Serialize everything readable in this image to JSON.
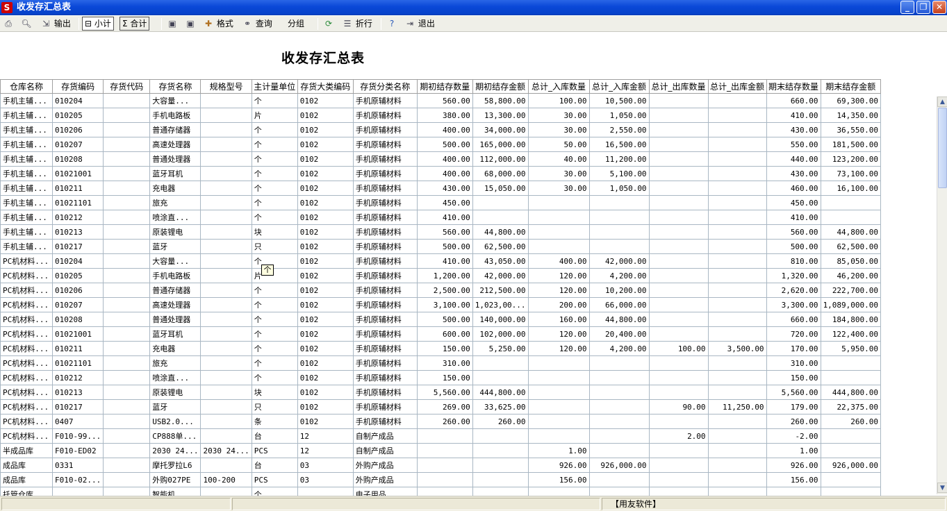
{
  "window": {
    "title": "收发存汇总表",
    "logo": "S",
    "min": "_",
    "restore": "❐",
    "close": "✕"
  },
  "toolbar": {
    "print_icon": "printer-icon",
    "preview_icon": "preview-icon",
    "output_icon": "export-icon",
    "output": "输出",
    "subtotal": "小计",
    "subtotal_glyph": "⊟",
    "total": "合计",
    "total_glyph": "Σ",
    "save_icon": "save-icon",
    "saveas_icon": "save-as-icon",
    "format": "格式",
    "query": "查询",
    "group": "分组",
    "refresh_icon": "refresh-icon",
    "wrap": "折行",
    "help_icon": "help-icon",
    "exit": "退出"
  },
  "report": {
    "title": "收发存汇总表",
    "columns": [
      "仓库名称",
      "存货编码",
      "存货代码",
      "存货名称",
      "规格型号",
      "主计量单位",
      "存货大类编码",
      "存货分类名称",
      "期初结存数量",
      "期初结存金额",
      "总计_入库数量",
      "总计_入库金额",
      "总计_出库数量",
      "总计_出库金额",
      "期末结存数量",
      "期末结存金额"
    ],
    "rows": [
      [
        "手机主辅...",
        "010204",
        "",
        "大容量...",
        "",
        "个",
        "0102",
        "手机原辅材料",
        "560.00",
        "58,800.00",
        "100.00",
        "10,500.00",
        "",
        "",
        "660.00",
        "69,300.00"
      ],
      [
        "手机主辅...",
        "010205",
        "",
        "手机电路板",
        "",
        "片",
        "0102",
        "手机原辅材料",
        "380.00",
        "13,300.00",
        "30.00",
        "1,050.00",
        "",
        "",
        "410.00",
        "14,350.00"
      ],
      [
        "手机主辅...",
        "010206",
        "",
        "普通存储器",
        "",
        "个",
        "0102",
        "手机原辅材料",
        "400.00",
        "34,000.00",
        "30.00",
        "2,550.00",
        "",
        "",
        "430.00",
        "36,550.00"
      ],
      [
        "手机主辅...",
        "010207",
        "",
        "高速处理器",
        "",
        "个",
        "0102",
        "手机原辅材料",
        "500.00",
        "165,000.00",
        "50.00",
        "16,500.00",
        "",
        "",
        "550.00",
        "181,500.00"
      ],
      [
        "手机主辅...",
        "010208",
        "",
        "普通处理器",
        "",
        "个",
        "0102",
        "手机原辅材料",
        "400.00",
        "112,000.00",
        "40.00",
        "11,200.00",
        "",
        "",
        "440.00",
        "123,200.00"
      ],
      [
        "手机主辅...",
        "01021001",
        "",
        "蓝牙耳机",
        "",
        "个",
        "0102",
        "手机原辅材料",
        "400.00",
        "68,000.00",
        "30.00",
        "5,100.00",
        "",
        "",
        "430.00",
        "73,100.00"
      ],
      [
        "手机主辅...",
        "010211",
        "",
        "充电器",
        "",
        "个",
        "0102",
        "手机原辅材料",
        "430.00",
        "15,050.00",
        "30.00",
        "1,050.00",
        "",
        "",
        "460.00",
        "16,100.00"
      ],
      [
        "手机主辅...",
        "01021101",
        "",
        "旅充",
        "",
        "个",
        "0102",
        "手机原辅材料",
        "450.00",
        "",
        "",
        "",
        "",
        "",
        "450.00",
        ""
      ],
      [
        "手机主辅...",
        "010212",
        "",
        "喷涂直...",
        "",
        "个",
        "0102",
        "手机原辅材料",
        "410.00",
        "",
        "",
        "",
        "",
        "",
        "410.00",
        ""
      ],
      [
        "手机主辅...",
        "010213",
        "",
        "原装锂电",
        "",
        "块",
        "0102",
        "手机原辅材料",
        "560.00",
        "44,800.00",
        "",
        "",
        "",
        "",
        "560.00",
        "44,800.00"
      ],
      [
        "手机主辅...",
        "010217",
        "",
        "蓝牙",
        "",
        "只",
        "0102",
        "手机原辅材料",
        "500.00",
        "62,500.00",
        "",
        "",
        "",
        "",
        "500.00",
        "62,500.00"
      ],
      [
        "PC机材料...",
        "010204",
        "",
        "大容量...",
        "",
        "个",
        "0102",
        "手机原辅材料",
        "410.00",
        "43,050.00",
        "400.00",
        "42,000.00",
        "",
        "",
        "810.00",
        "85,050.00"
      ],
      [
        "PC机材料...",
        "010205",
        "",
        "手机电路板",
        "",
        "片",
        "0102",
        "手机原辅材料",
        "1,200.00",
        "42,000.00",
        "120.00",
        "4,200.00",
        "",
        "",
        "1,320.00",
        "46,200.00"
      ],
      [
        "PC机材料...",
        "010206",
        "",
        "普通存储器",
        "",
        "个",
        "0102",
        "手机原辅材料",
        "2,500.00",
        "212,500.00",
        "120.00",
        "10,200.00",
        "",
        "",
        "2,620.00",
        "222,700.00"
      ],
      [
        "PC机材料...",
        "010207",
        "",
        "高速处理器",
        "",
        "个",
        "0102",
        "手机原辅材料",
        "3,100.00",
        "1,023,00...",
        "200.00",
        "66,000.00",
        "",
        "",
        "3,300.00",
        "1,089,000.00"
      ],
      [
        "PC机材料...",
        "010208",
        "",
        "普通处理器",
        "",
        "个",
        "0102",
        "手机原辅材料",
        "500.00",
        "140,000.00",
        "160.00",
        "44,800.00",
        "",
        "",
        "660.00",
        "184,800.00"
      ],
      [
        "PC机材料...",
        "01021001",
        "",
        "蓝牙耳机",
        "",
        "个",
        "0102",
        "手机原辅材料",
        "600.00",
        "102,000.00",
        "120.00",
        "20,400.00",
        "",
        "",
        "720.00",
        "122,400.00"
      ],
      [
        "PC机材料...",
        "010211",
        "",
        "充电器",
        "",
        "个",
        "0102",
        "手机原辅材料",
        "150.00",
        "5,250.00",
        "120.00",
        "4,200.00",
        "100.00",
        "3,500.00",
        "170.00",
        "5,950.00"
      ],
      [
        "PC机材料...",
        "01021101",
        "",
        "旅充",
        "",
        "个",
        "0102",
        "手机原辅材料",
        "310.00",
        "",
        "",
        "",
        "",
        "",
        "310.00",
        ""
      ],
      [
        "PC机材料...",
        "010212",
        "",
        "喷涂直...",
        "",
        "个",
        "0102",
        "手机原辅材料",
        "150.00",
        "",
        "",
        "",
        "",
        "",
        "150.00",
        ""
      ],
      [
        "PC机材料...",
        "010213",
        "",
        "原装锂电",
        "",
        "块",
        "0102",
        "手机原辅材料",
        "5,560.00",
        "444,800.00",
        "",
        "",
        "",
        "",
        "5,560.00",
        "444,800.00"
      ],
      [
        "PC机材料...",
        "010217",
        "",
        "蓝牙",
        "",
        "只",
        "0102",
        "手机原辅材料",
        "269.00",
        "33,625.00",
        "",
        "",
        "90.00",
        "11,250.00",
        "179.00",
        "22,375.00"
      ],
      [
        "PC机材料...",
        "0407",
        "",
        "USB2.0...",
        "",
        "条",
        "0102",
        "手机原辅材料",
        "260.00",
        "260.00",
        "",
        "",
        "",
        "",
        "260.00",
        "260.00"
      ],
      [
        "PC机材料...",
        "F010-99...",
        "",
        "CP888单...",
        "",
        "台",
        "12",
        "自制产成品",
        "",
        "",
        "",
        "",
        "2.00",
        "",
        "-2.00",
        ""
      ],
      [
        "半成品库",
        "F010-ED02",
        "",
        "2030 24...",
        "2030 24...",
        "PCS",
        "12",
        "自制产成品",
        "",
        "",
        "1.00",
        "",
        "",
        "",
        "1.00",
        ""
      ],
      [
        "成品库",
        "0331",
        "",
        "摩托罗拉L6",
        "",
        "台",
        "03",
        "外购产成品",
        "",
        "",
        "926.00",
        "926,000.00",
        "",
        "",
        "926.00",
        "926,000.00"
      ],
      [
        "成品库",
        "F010-02...",
        "",
        "外购027PE",
        "100-200",
        "PCS",
        "03",
        "外购产成品",
        "",
        "",
        "156.00",
        "",
        "",
        "",
        "156.00",
        ""
      ],
      [
        "托管仓库",
        "",
        "",
        "智能机",
        "",
        "个",
        "",
        "电子用品",
        "",
        "",
        "",
        "",
        "",
        "",
        "",
        ""
      ]
    ]
  },
  "tooltip": "个",
  "scrollbar": {
    "up": "▲",
    "down": "▼"
  },
  "status": {
    "left": "",
    "middle": "",
    "company": "【用友软件】"
  }
}
